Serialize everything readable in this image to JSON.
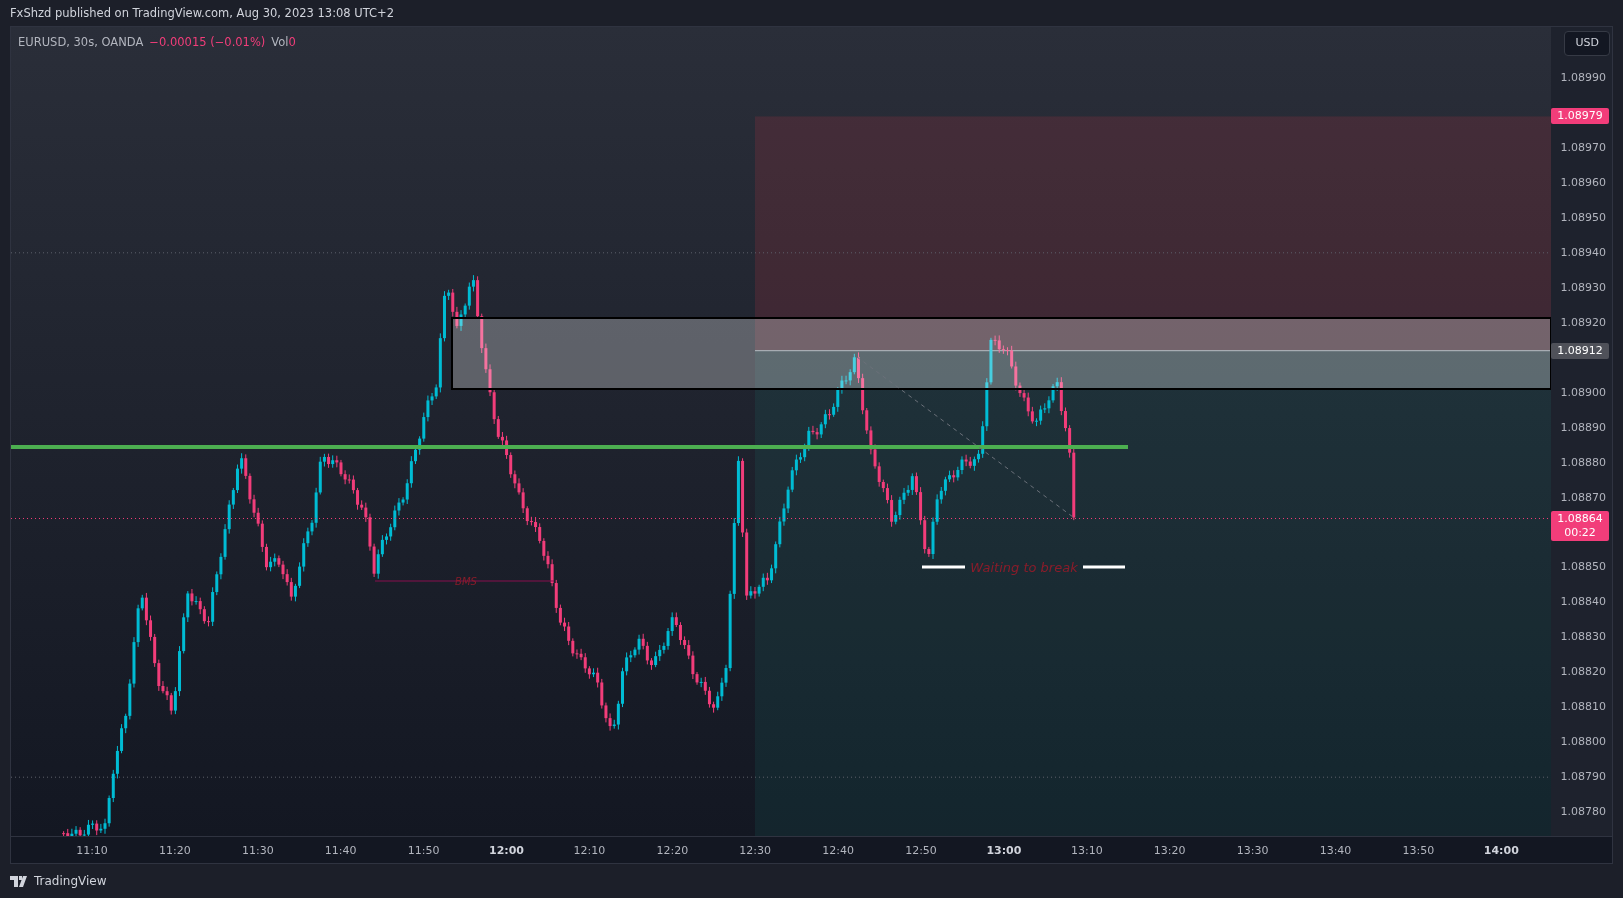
{
  "header": {
    "text": "FxShzd published on TradingView.com, Aug 30, 2023 13:08 UTC+2"
  },
  "legend": {
    "symbol": "EURUSD, 30s, OANDA",
    "change": "−0.00015 (−0.01%)",
    "volume_label": "Vol",
    "volume": "0"
  },
  "currency_button": "USD",
  "price_axis": {
    "ticks": [
      "1.08990",
      "1.08970",
      "1.08960",
      "1.08950",
      "1.08940",
      "1.08930",
      "1.08920",
      "1.08900",
      "1.08890",
      "1.08880",
      "1.08870",
      "1.08850",
      "1.08840",
      "1.08830",
      "1.08820",
      "1.08810",
      "1.08800",
      "1.08790",
      "1.08780"
    ],
    "markers": [
      {
        "kind": "target",
        "label": "1.08979"
      },
      {
        "kind": "entry",
        "label": "1.08912"
      },
      {
        "kind": "last",
        "label": "1.08864",
        "countdown": "00:22"
      }
    ]
  },
  "annotations": [
    {
      "kind": "bms",
      "text": "BMS"
    },
    {
      "kind": "waiting",
      "text": "Waiting to break"
    }
  ],
  "time_axis": [
    {
      "label": "11:10",
      "major": false
    },
    {
      "label": "11:20",
      "major": false
    },
    {
      "label": "11:30",
      "major": false
    },
    {
      "label": "11:40",
      "major": false
    },
    {
      "label": "11:50",
      "major": false
    },
    {
      "label": "12:00",
      "major": true
    },
    {
      "label": "12:10",
      "major": false
    },
    {
      "label": "12:20",
      "major": false
    },
    {
      "label": "12:30",
      "major": false
    },
    {
      "label": "12:40",
      "major": false
    },
    {
      "label": "12:50",
      "major": false
    },
    {
      "label": "13:00",
      "major": true
    },
    {
      "label": "13:10",
      "major": false
    },
    {
      "label": "13:20",
      "major": false
    },
    {
      "label": "13:30",
      "major": false
    },
    {
      "label": "13:40",
      "major": false
    },
    {
      "label": "13:50",
      "major": false
    },
    {
      "label": "14:00",
      "major": true
    }
  ],
  "footer": {
    "brand": "TradingView"
  }
}
